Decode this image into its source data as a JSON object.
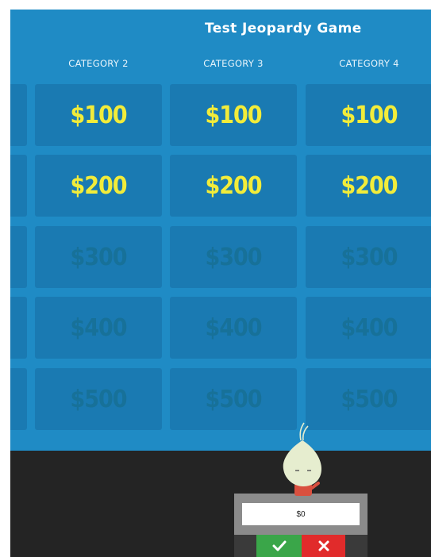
{
  "game": {
    "title": "Test Jeopardy Game"
  },
  "categories": [
    "CATEGORY 2",
    "CATEGORY 3",
    "CATEGORY 4"
  ],
  "tiles": {
    "row1": [
      "$100",
      "$100",
      "$100"
    ],
    "row2": [
      "$200",
      "$200",
      "$200"
    ],
    "row3": [
      "$300",
      "$300",
      "$300"
    ],
    "row4": [
      "$400",
      "$400",
      "$400"
    ],
    "row5": [
      "$500",
      "$500",
      "$500"
    ]
  },
  "player": {
    "score": "$0",
    "correct_icon": "check-icon",
    "wrong_icon": "close-icon"
  },
  "colors": {
    "board": "#1f8bc5",
    "tile": "#1a7ab2",
    "active_value": "#f2ec3a",
    "used_value": "#177199",
    "stage": "#242424",
    "correct": "#3aa649",
    "wrong": "#e12b2b"
  }
}
